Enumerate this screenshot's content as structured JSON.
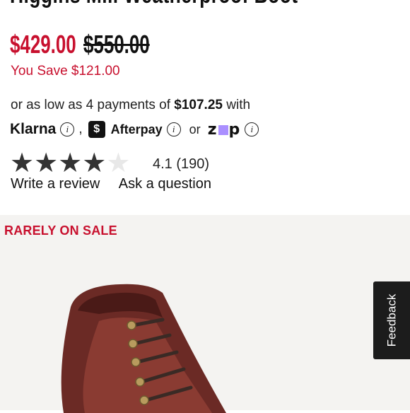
{
  "product": {
    "title": "Higgins Mill Weatherproof Boot",
    "sale_price": "$429.00",
    "original_price": "$550.00",
    "you_save": "You Save $121.00"
  },
  "installments": {
    "prefix": "or as low as 4 payments of",
    "amount": "$107.25",
    "suffix": "with",
    "klarna_label": "Klarna",
    "comma": ",",
    "afterpay_label": "Afterpay",
    "or_label": "or",
    "zip_label_left": "z",
    "zip_label_right": "p"
  },
  "rating": {
    "value": 4.1,
    "stars_filled": 4,
    "stars_total": 5,
    "text": "4.1 (190)",
    "write_review": "Write a review",
    "ask_question": "Ask a question"
  },
  "product_image": {
    "badge": "RARELY ON SALE"
  },
  "feedback_tab": {
    "label": "Feedback"
  },
  "colors": {
    "sale_red": "#c8102e",
    "star_fill": "#333333",
    "zip_purple": "#aa8fff",
    "feedback_bg": "#1c1c1c"
  }
}
